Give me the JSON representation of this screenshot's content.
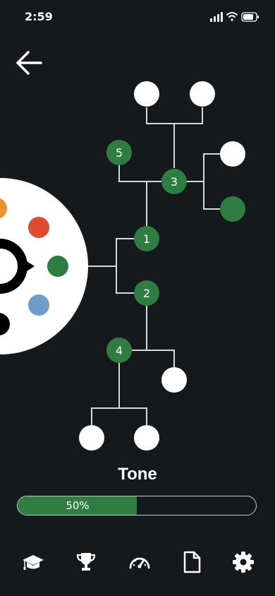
{
  "status_bar": {
    "time": "2:59",
    "icons": [
      "signal-icon",
      "wifi-icon",
      "battery-icon"
    ]
  },
  "header": {
    "back_icon": "arrow-left-icon"
  },
  "tree": {
    "node_labels": [
      "1",
      "2",
      "3",
      "4",
      "5"
    ],
    "colors": {
      "background": "#15191b",
      "node_active": "#2f7d43",
      "node_empty": "#ffffff",
      "line": "#d9d9d9",
      "wheel": "#ffffff"
    },
    "wheel_dot_colors": [
      "#e8932f",
      "#e04a35",
      "#2f7d43",
      "#6f9ccb",
      "#000000"
    ]
  },
  "skill": {
    "title": "Tone",
    "progress_label": "50%",
    "progress": 0.5
  },
  "bottom_nav": {
    "items": [
      "graduation-cap-icon",
      "trophy-icon",
      "speedometer-icon",
      "document-icon",
      "gear-icon"
    ]
  }
}
